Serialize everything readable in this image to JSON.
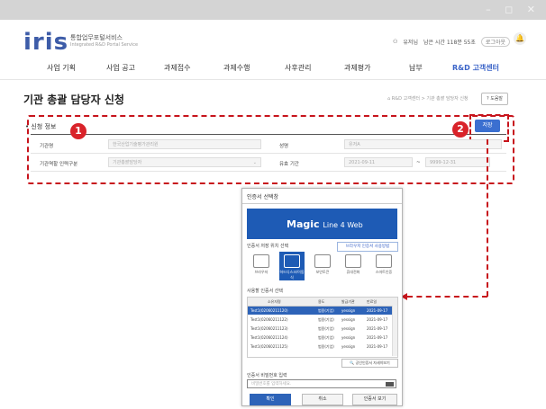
{
  "window": {
    "controls": "– ◻ ✕"
  },
  "header": {
    "logo": "iris",
    "service_name": "통합업무포털서비스",
    "service_sub": "Integrated R&D Portal Service",
    "user_name": "유저님",
    "session": "남은 시간 118분 55초",
    "extend_label": "로그아웃"
  },
  "nav": {
    "items": [
      "사업 기획",
      "사업 공고",
      "과제접수",
      "과제수행",
      "사후관리",
      "과제평가",
      "납부",
      "R&D 고객센터"
    ]
  },
  "page": {
    "title": "기관 총괄 담당자 신청",
    "breadcrumb": "R&D 고객센터 > 기관 총괄 담당자 신청",
    "help_label": "도움말"
  },
  "form": {
    "section_title": "신청 정보",
    "save_label": "저장",
    "marker1": "1",
    "marker2": "2",
    "rows": [
      {
        "label1": "기관명",
        "value1": "한국산업기술평가관리원",
        "label2": "성명",
        "value2": "유저A"
      },
      {
        "label1": "기관역할 인력구분",
        "value1": "기관총괄담당자",
        "label2": "유효 기간",
        "date_from": "2021-09-11",
        "date_to": "9999-12-31"
      }
    ]
  },
  "dialog": {
    "title": "인증서 선택창",
    "banner_main": "Magic",
    "banner_tail": "Line 4 Web",
    "location_label": "인증서 저장 위치 선택",
    "location_link": "브라우저 인증서 사용방법",
    "locations": [
      "브라우저",
      "하드디스크/이동식",
      "보안토큰",
      "휴대전화",
      "스마트인증"
    ],
    "cert_list_label": "사용할 인증서 선택",
    "columns": [
      "소유자명",
      "용도",
      "발급기관",
      "만료일"
    ],
    "certs": [
      {
        "owner": "Test1(02060211120)",
        "usage": "범용(기업)",
        "issuer": "yessign",
        "expiry": "2021-09-17"
      },
      {
        "owner": "Test1(02060211122)",
        "usage": "범용(기업)",
        "issuer": "yessign",
        "expiry": "2021-09-17"
      },
      {
        "owner": "Test1(02060211123)",
        "usage": "범용(기업)",
        "issuer": "yessign",
        "expiry": "2021-09-17"
      },
      {
        "owner": "Test1(02060211124)",
        "usage": "범용(기업)",
        "issuer": "yessign",
        "expiry": "2021-09-17"
      },
      {
        "owner": "Test1(02060211125)",
        "usage": "범용(기업)",
        "issuer": "yessign",
        "expiry": "2021-09-17"
      }
    ],
    "detail_label": "공인인증서 자세히보기",
    "password_label": "인증서 비밀번호 입력",
    "password_placeholder": "비밀번호를 입력하세요.",
    "ok_label": "확인",
    "cancel_label": "취소",
    "view_label": "인증서 보기"
  }
}
